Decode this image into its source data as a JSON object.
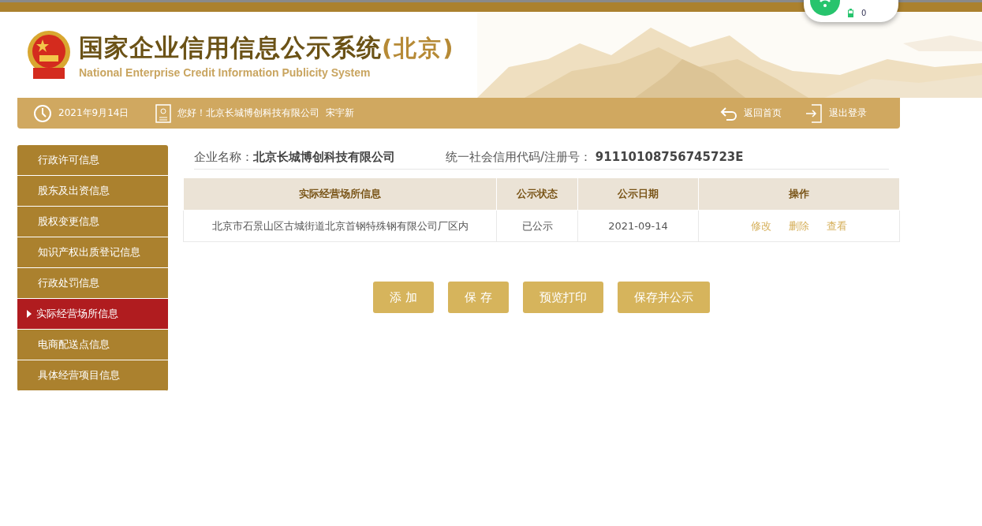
{
  "header": {
    "title": "国家企业信用信息公示系统",
    "region": "(北京)",
    "subtitle": "National Enterprise Credit Information Publicity System"
  },
  "status_widget": {
    "count": "0"
  },
  "info_bar": {
    "date": "2021年9月14日",
    "greeting": "您好！北京长城博创科技有限公司  宋宇新",
    "links": [
      "返回首页",
      "退出登录"
    ]
  },
  "sidebar": {
    "items": [
      {
        "label": "行政许可信息",
        "selected": false
      },
      {
        "label": "股东及出资信息",
        "selected": false
      },
      {
        "label": "股权变更信息",
        "selected": false
      },
      {
        "label": "知识产权出质登记信息",
        "selected": false
      },
      {
        "label": "行政处罚信息",
        "selected": false
      },
      {
        "label": "实际经营场所信息",
        "selected": true
      },
      {
        "label": "电商配送点信息",
        "selected": false
      },
      {
        "label": "具体经营项目信息",
        "selected": false
      }
    ]
  },
  "company": {
    "name_label": "企业名称：",
    "name": "北京长城博创科技有限公司",
    "code_label": "统一社会信用代码/注册号：",
    "code": "91110108756745723E"
  },
  "table": {
    "columns": [
      "实际经营场所信息",
      "公示状态",
      "公示日期",
      "操作"
    ],
    "rows": [
      {
        "cells": [
          "北京市石景山区古城街道北京首钢特殊钢有限公司厂区内",
          "已公示",
          "2021-09-14"
        ],
        "actions": [
          "修改",
          "删除",
          "查看"
        ]
      }
    ]
  },
  "buttons": [
    "添 加",
    "保 存",
    "预览打印",
    "保存并公示"
  ]
}
